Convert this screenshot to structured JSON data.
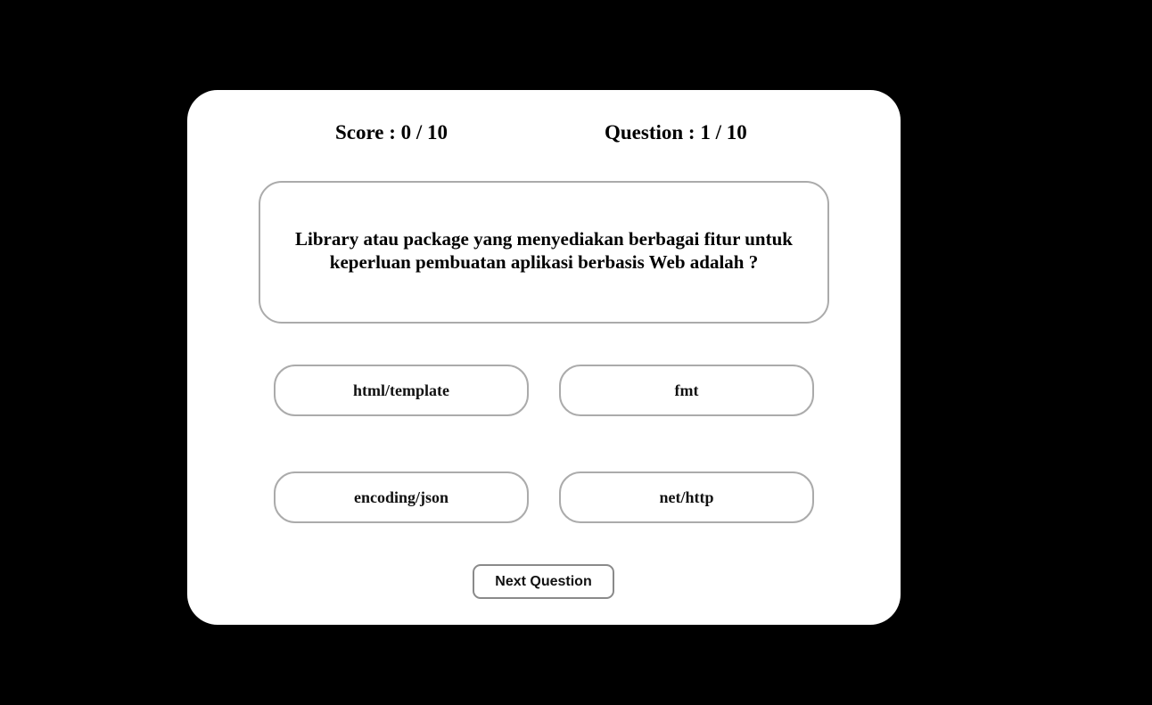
{
  "header": {
    "score": "Score : 0 / 10",
    "question_counter": "Question : 1 / 10"
  },
  "question": {
    "text": "Library atau package yang menyediakan berbagai fitur untuk keperluan pembuatan aplikasi berbasis Web adalah ?"
  },
  "options": [
    {
      "label": "html/template"
    },
    {
      "label": "fmt"
    },
    {
      "label": "encoding/json"
    },
    {
      "label": "net/http"
    }
  ],
  "actions": {
    "next_label": "Next Question"
  },
  "colors": {
    "background": "#000000",
    "card": "#ffffff",
    "border": "#ababab"
  }
}
